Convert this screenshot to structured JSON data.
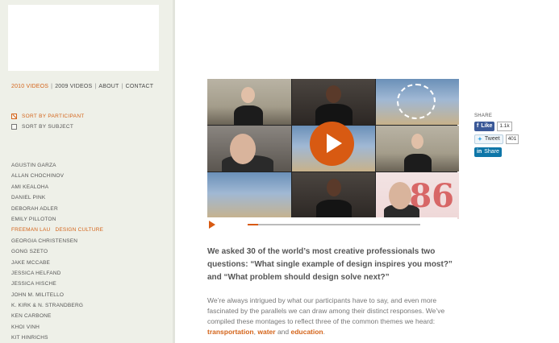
{
  "nav": {
    "items": [
      {
        "label": "2010 VIDEOS",
        "active": true
      },
      {
        "label": "2009 VIDEOS",
        "active": false
      },
      {
        "label": "ABOUT",
        "active": false
      },
      {
        "label": "CONTACT",
        "active": false
      }
    ],
    "separator": "|"
  },
  "sort": {
    "by_participant": "SORT BY PARTICIPANT",
    "by_subject": "SORT BY SUBJECT",
    "selected": "participant"
  },
  "participants": [
    {
      "name": "AGUSTIN GARZA"
    },
    {
      "name": "ALLAN CHOCHINOV"
    },
    {
      "name": "AMI KEALOHA"
    },
    {
      "name": "DANIEL PINK"
    },
    {
      "name": "DEBORAH ADLER"
    },
    {
      "name": "EMILY PILLOTON"
    },
    {
      "name": "FREEMAN LAU",
      "sub": "DESIGN CULTURE",
      "active": true
    },
    {
      "name": "GEORGIA CHRISTENSEN"
    },
    {
      "name": "GONG SZETO"
    },
    {
      "name": "JAKE MCCABE"
    },
    {
      "name": "JESSICA HELFAND"
    },
    {
      "name": "JESSICA HISCHE"
    },
    {
      "name": "JOHN M. MILITELLO"
    },
    {
      "name": "K. KIRK & N. STRANDBERG"
    },
    {
      "name": "KEN CARBONE"
    },
    {
      "name": "KHOI VINH"
    },
    {
      "name": "KIT HINRICHS"
    }
  ],
  "video": {
    "progress": 0.06,
    "red_text": "86"
  },
  "share": {
    "label": "SHARE",
    "facebook": {
      "label": "Like",
      "count": "1.1k"
    },
    "twitter": {
      "label": "Tweet",
      "count": "401"
    },
    "linkedin": {
      "label": "Share"
    }
  },
  "content": {
    "intro": "We asked 30 of the world’s most creative professionals two questions: “What single example of design inspires you most?” and “What problem should design solve next?”",
    "body_prefix": "We’re always intrigued by what our participants have to say, and even more fascinated by the parallels we can draw among their distinct responses. We’ve compiled these montages to reflect three of the common themes we heard: ",
    "link_transportation": "transportation",
    "comma": ", ",
    "link_water": "water",
    "and": " and ",
    "link_education": "education",
    "end": "."
  },
  "colors": {
    "accent": "#d4641a",
    "sidebar_bg": "#eef0e8",
    "play_button": "#d85a12"
  }
}
